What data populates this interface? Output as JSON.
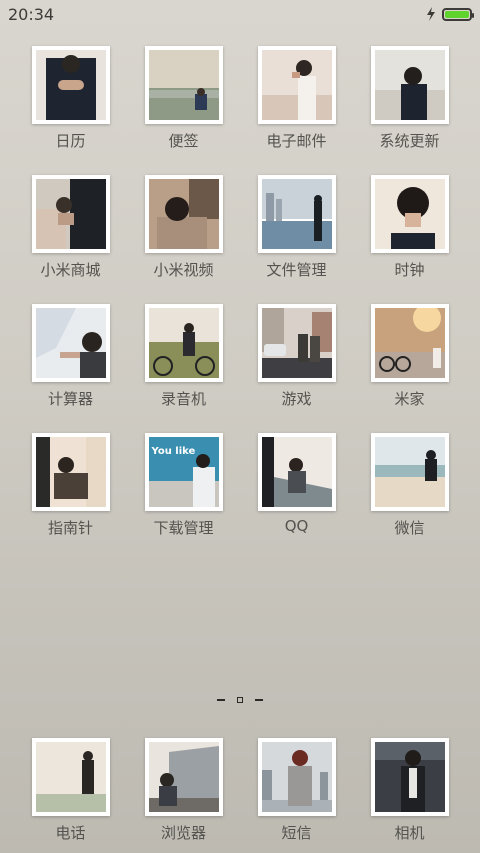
{
  "status": {
    "time": "20:34",
    "charging_icon": "lightning-icon",
    "battery_color": "#5fd32e"
  },
  "apps": [
    {
      "label": "日历",
      "name": "calendar"
    },
    {
      "label": "便签",
      "name": "notes"
    },
    {
      "label": "电子邮件",
      "name": "email"
    },
    {
      "label": "系统更新",
      "name": "system-update"
    },
    {
      "label": "小米商城",
      "name": "mi-store"
    },
    {
      "label": "小米视频",
      "name": "mi-video"
    },
    {
      "label": "文件管理",
      "name": "file-manager"
    },
    {
      "label": "时钟",
      "name": "clock"
    },
    {
      "label": "计算器",
      "name": "calculator"
    },
    {
      "label": "录音机",
      "name": "recorder"
    },
    {
      "label": "游戏",
      "name": "games"
    },
    {
      "label": "米家",
      "name": "mi-home"
    },
    {
      "label": "指南针",
      "name": "compass"
    },
    {
      "label": "下载管理",
      "name": "downloads"
    },
    {
      "label": "QQ",
      "name": "qq"
    },
    {
      "label": "微信",
      "name": "wechat"
    }
  ],
  "icon_overlay_text": {
    "downloads": "You like"
  },
  "dock": [
    {
      "label": "电话",
      "name": "phone"
    },
    {
      "label": "浏览器",
      "name": "browser"
    },
    {
      "label": "短信",
      "name": "messages"
    },
    {
      "label": "相机",
      "name": "camera"
    }
  ]
}
